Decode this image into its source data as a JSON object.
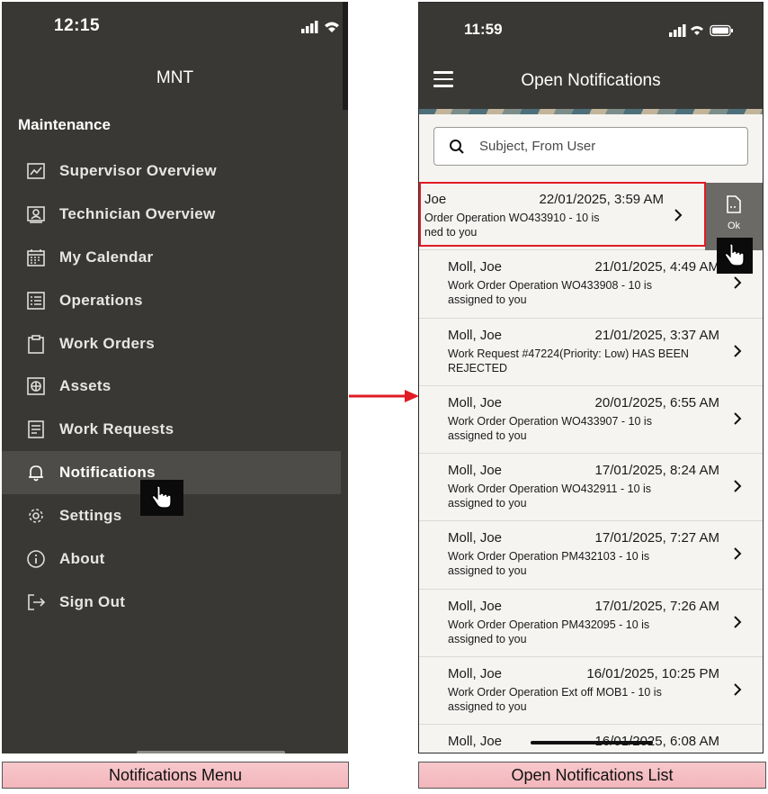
{
  "colors": {
    "dark_bg": "#3a3834",
    "active_item": "#4e4c48",
    "highlight_red": "#e01b24",
    "caption_bg": "#f5bfc4"
  },
  "left_screen": {
    "time": "12:15",
    "app_title": "MNT",
    "section": "Maintenance",
    "menu": [
      {
        "label": "Supervisor Overview",
        "icon": "chart-icon"
      },
      {
        "label": "Technician Overview",
        "icon": "technician-icon"
      },
      {
        "label": "My Calendar",
        "icon": "calendar-icon"
      },
      {
        "label": "Operations",
        "icon": "list-icon"
      },
      {
        "label": "Work Orders",
        "icon": "clipboard-icon"
      },
      {
        "label": "Assets",
        "icon": "asset-icon"
      },
      {
        "label": "Work Requests",
        "icon": "document-icon"
      },
      {
        "label": "Notifications",
        "icon": "bell-icon",
        "active": true
      },
      {
        "label": "Settings",
        "icon": "gear-icon"
      },
      {
        "label": "About",
        "icon": "info-icon"
      },
      {
        "label": "Sign Out",
        "icon": "sign-out-icon"
      }
    ]
  },
  "right_screen": {
    "time": "11:59",
    "title": "Open Notifications",
    "search_placeholder": "Subject, From User",
    "swipe_action_label": "Ok",
    "notifications": [
      {
        "from": "Joe",
        "date": "22/01/2025, 3:59 AM",
        "subject": "Order Operation WO433910 - 10 is",
        "subject2": "ned to you"
      },
      {
        "from": "Moll, Joe",
        "date": "21/01/2025, 4:49 AM",
        "subject": "Work Order Operation WO433908 - 10 is",
        "subject2": "assigned to you"
      },
      {
        "from": "Moll, Joe",
        "date": "21/01/2025, 3:37 AM",
        "subject": "Work Request #47224(Priority: Low) HAS BEEN",
        "subject2": "REJECTED"
      },
      {
        "from": "Moll, Joe",
        "date": "20/01/2025, 6:55 AM",
        "subject": "Work Order Operation WO433907 - 10 is",
        "subject2": "assigned to you"
      },
      {
        "from": "Moll, Joe",
        "date": "17/01/2025, 8:24 AM",
        "subject": "Work Order Operation WO432911 - 10 is",
        "subject2": "assigned to you"
      },
      {
        "from": "Moll, Joe",
        "date": "17/01/2025, 7:27 AM",
        "subject": "Work Order Operation PM432103 - 10 is",
        "subject2": "assigned to you"
      },
      {
        "from": "Moll, Joe",
        "date": "17/01/2025, 7:26 AM",
        "subject": "Work Order Operation PM432095 - 10 is",
        "subject2": "assigned to you"
      },
      {
        "from": "Moll, Joe",
        "date": "16/01/2025, 10:25 PM",
        "subject": "Work Order Operation Ext off MOB1 - 10 is",
        "subject2": "assigned to you"
      },
      {
        "from": "Moll, Joe",
        "date": "16/01/2025, 6:08 AM",
        "subject": "",
        "subject2": ""
      }
    ]
  },
  "captions": {
    "left": "Notifications Menu",
    "right": "Open Notifications List"
  }
}
